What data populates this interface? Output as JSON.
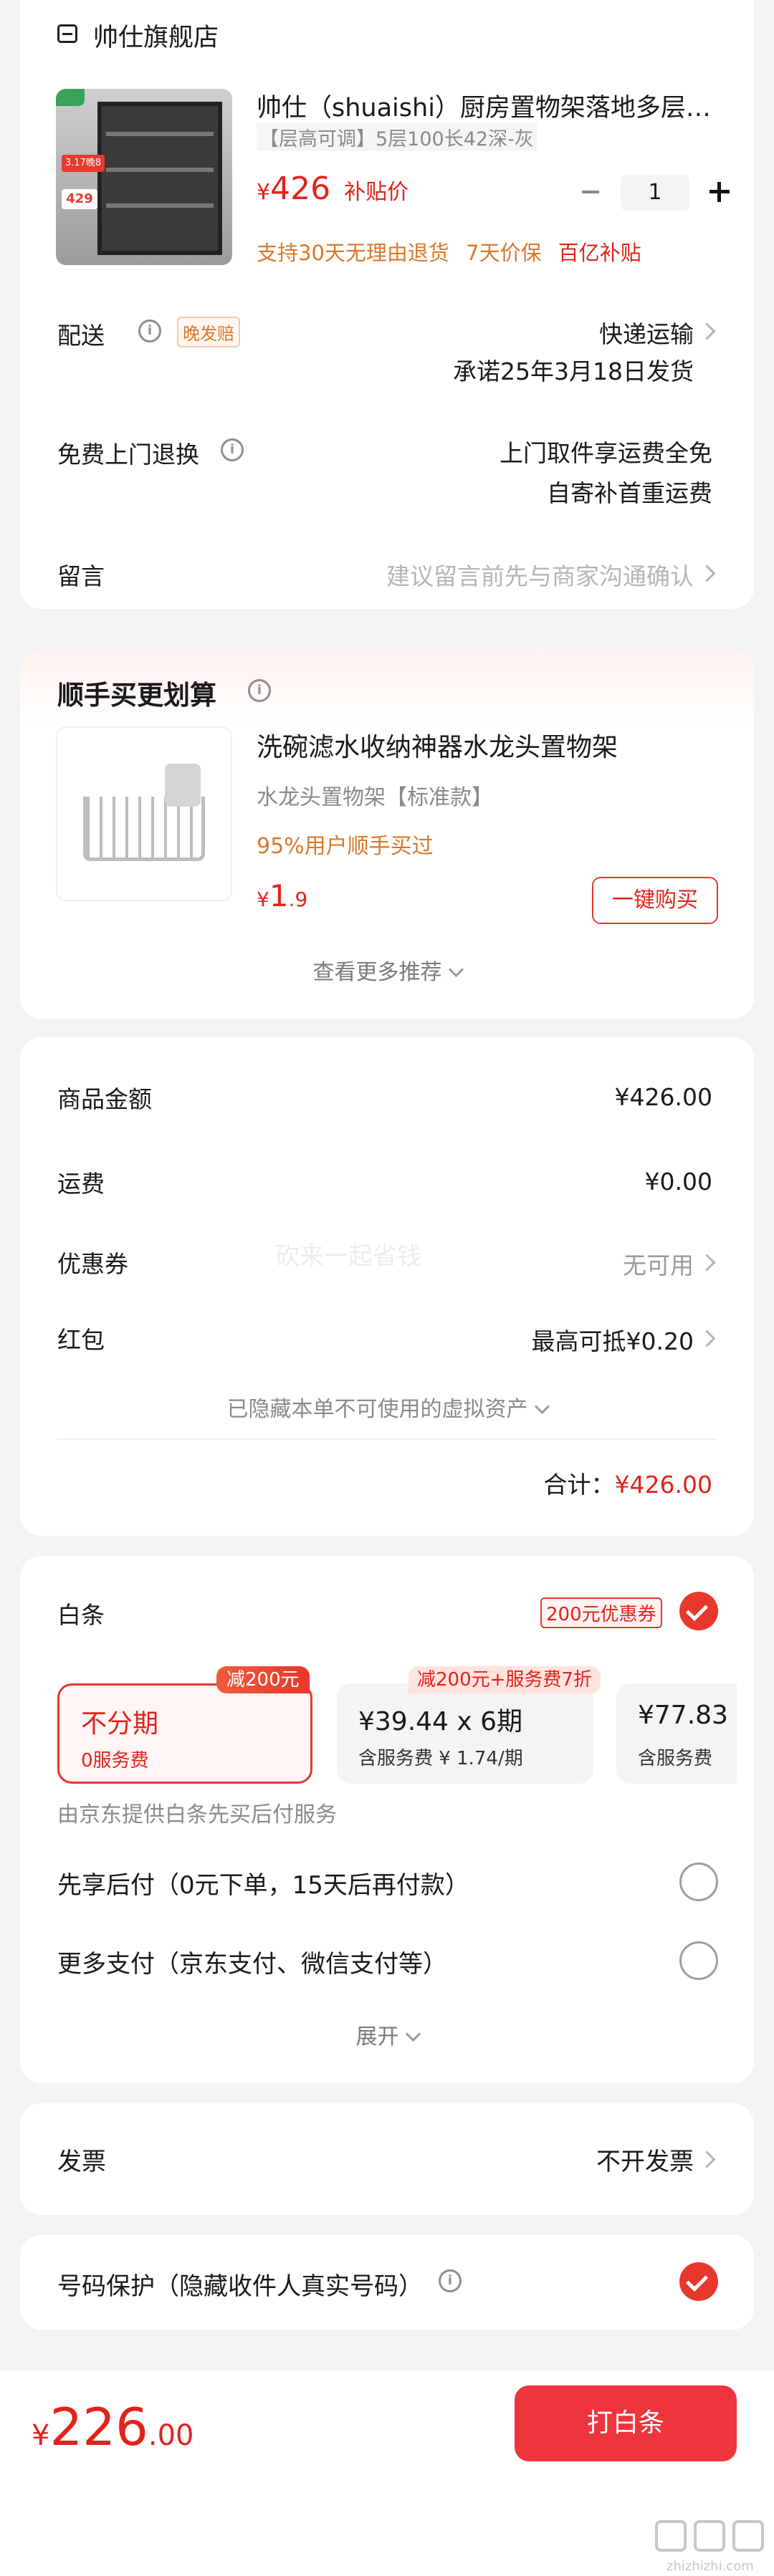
{
  "store": {
    "name": "帅仕旗舰店"
  },
  "product": {
    "title": "帅仕（shuaishi）厨房置物架落地多层…",
    "spec": "【层高可调】5层100长42深-灰",
    "price_symbol": "¥",
    "price": "426",
    "subsidy": "补贴价",
    "quantity": "1",
    "tags": [
      "支持30天无理由退货",
      "7天价保",
      "百亿补贴"
    ],
    "thumb_badge_left": "3.17晚8",
    "thumb_badge_price": "429"
  },
  "delivery": {
    "label": "配送",
    "badge": "晚发赔",
    "method": "快递运输",
    "promise": "承诺25年3月18日发货"
  },
  "return_service": {
    "label": "免费上门退换",
    "line1": "上门取件享运费全免",
    "line2": "自寄补首重运费"
  },
  "message": {
    "label": "留言",
    "placeholder": "建议留言前先与商家沟通确认"
  },
  "addon": {
    "title": "顺手买更划算",
    "item_title": "洗碗滤水收纳神器水龙头置物架",
    "item_spec": "水龙头置物架【标准款】",
    "item_note": "95%用户顺手买过",
    "item_price_symbol": "¥",
    "item_price_int": "1",
    "item_price_dec": ".9",
    "buy_button": "一键购买",
    "more": "查看更多推荐"
  },
  "summary": {
    "goods_label": "商品金额",
    "goods_value": "¥426.00",
    "shipping_label": "运费",
    "shipping_value": "¥0.00",
    "coupon_label": "优惠券",
    "coupon_value": "无可用",
    "redpack_label": "红包",
    "redpack_value": "最高可抵¥0.20",
    "hidden_note": "已隐藏本单不可使用的虚拟资产",
    "total_label": "合计：",
    "total_value": "¥426.00",
    "watermark": "砍来一起省钱"
  },
  "payment": {
    "baitiao_label": "白条",
    "coupon_tag": "200元优惠券",
    "options": [
      {
        "tag": "减200元",
        "title": "不分期",
        "sub": "0服务费"
      },
      {
        "tag": "减200元+服务费7折",
        "title_price": "¥39.44",
        "title_mult": "x 6期",
        "sub": "含服务费 ¥ 1.74/期"
      },
      {
        "title_price": "¥77.83",
        "sub": "含服务费"
      }
    ],
    "provider_note": "由京东提供白条先买后付服务",
    "pay_later": "先享后付（0元下单，15天后再付款）",
    "more_pay": "更多支付（京东支付、微信支付等）",
    "expand": "展开"
  },
  "invoice": {
    "label": "发票",
    "value": "不开发票"
  },
  "privacy": {
    "label": "号码保护（隐藏收件人真实号码）"
  },
  "footer": {
    "symbol": "¥",
    "amount_int": "226",
    "amount_dec": ".00",
    "button": "打白条",
    "watermark_text": "zhizhizhi.com"
  },
  "colors": {
    "accent": "#e2231a",
    "button": "#f0343e"
  }
}
